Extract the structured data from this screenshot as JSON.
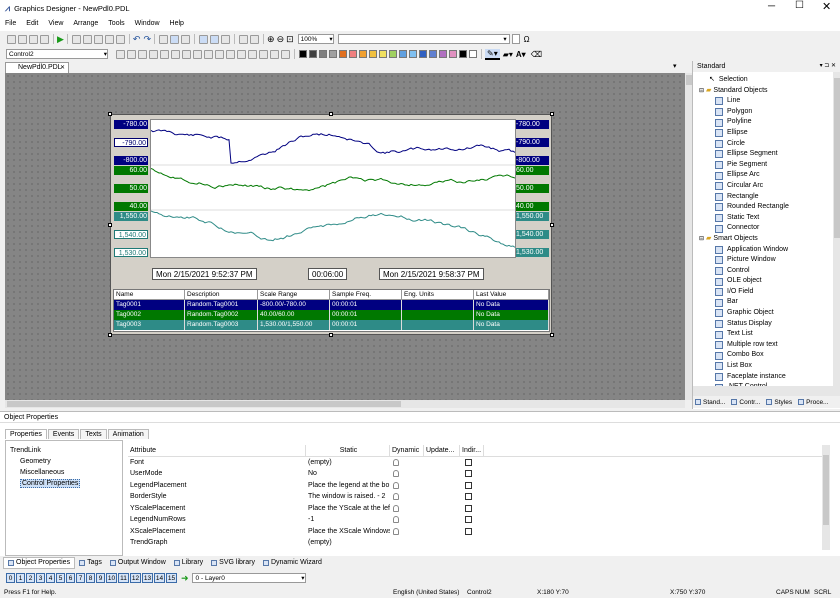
{
  "title": "Graphics Designer - NewPdl0.PDL",
  "menu": [
    "File",
    "Edit",
    "View",
    "Arrange",
    "Tools",
    "Window",
    "Help"
  ],
  "toolbar": {
    "zoom": "100%",
    "object_name": "Control2"
  },
  "document_tab": "NewPdl0.PDL",
  "trend": {
    "left_axis": {
      "blue": [
        "-780.00",
        "-790.00",
        "-800.00"
      ],
      "green": [
        "60.00",
        "50.00",
        "40.00"
      ],
      "teal": [
        "1,550.00",
        "1,540.00",
        "1,530.00"
      ]
    },
    "right_axis": {
      "blue": [
        "-780.00",
        "-790.00",
        "-800.00"
      ],
      "green": [
        "60.00",
        "50.00",
        "40.00"
      ],
      "teal": [
        "1,550.00",
        "1,540.00",
        "1,530.00"
      ]
    },
    "time_start": "Mon 2/15/2021   9:52:37 PM",
    "time_range": "00:06:00",
    "time_end": "Mon 2/15/2021   9:58:37 PM",
    "columns": [
      "Name",
      "Description",
      "Scale Range",
      "Sample Freq.",
      "Eng. Units",
      "Last Value"
    ],
    "rows": [
      [
        "Tag0001",
        "Random.Tag0001",
        "-800.00/-780.00",
        "00:00:01",
        "",
        "No Data"
      ],
      [
        "Tag0002",
        "Random.Tag0002",
        "40.00/60.00",
        "00:00:01",
        "",
        "No Data"
      ],
      [
        "Tag0003",
        "Random.Tag0003",
        "1,530.00/1,550.00",
        "00:00:01",
        "",
        "No Data"
      ]
    ],
    "colors": {
      "blue": "#000080",
      "green": "#007800",
      "teal": "#2e8b87"
    }
  },
  "standard_panel": {
    "title": "Standard",
    "selection": "Selection",
    "standard_objects": "Standard Objects",
    "std_items": [
      "Line",
      "Polygon",
      "Polyline",
      "Ellipse",
      "Circle",
      "Ellipse Segment",
      "Pie Segment",
      "Ellipse Arc",
      "Circular Arc",
      "Rectangle",
      "Rounded Rectangle",
      "Static Text",
      "Connector"
    ],
    "smart_objects": "Smart Objects",
    "smart_items": [
      "Application Window",
      "Picture Window",
      "Control",
      "OLE object",
      "I/O Field",
      "Bar",
      "Graphic Object",
      "Status Display",
      "Text List",
      "Multiple row text",
      "Combo Box",
      "List Box",
      "Faceplate instance",
      ".NET Control"
    ],
    "tabs": [
      "Stand...",
      "Contr...",
      "Styles",
      "Proce..."
    ]
  },
  "object_properties": {
    "title": "Object Properties",
    "tabs": [
      "Properties",
      "Events",
      "Texts",
      "Animation"
    ],
    "tree": [
      "TrendLink",
      "Geometry",
      "Miscellaneous",
      "Control Properties"
    ],
    "headers": [
      "Attribute",
      "Static",
      "Dynamic",
      "Update...",
      "Indir..."
    ],
    "rows": [
      [
        "Font",
        "(empty)"
      ],
      [
        "UserMode",
        "No"
      ],
      [
        "LegendPlacement",
        "Place the legend at the bo"
      ],
      [
        "BorderStyle",
        "The window is raised. - 2"
      ],
      [
        "YScalePlacement",
        "Place the YScale at the left"
      ],
      [
        "LegendNumRows",
        "-1"
      ],
      [
        "XScalePlacement",
        "Place the XScale Windows"
      ],
      [
        "TrendGraph",
        "(empty)"
      ]
    ]
  },
  "bottom_tabs": [
    "Object Properties",
    "Tags",
    "Output Window",
    "Library",
    "SVG library",
    "Dynamic Wizard"
  ],
  "layers": [
    "0",
    "1",
    "2",
    "3",
    "4",
    "5",
    "6",
    "7",
    "8",
    "9",
    "10",
    "11",
    "12",
    "13",
    "14",
    "15"
  ],
  "layer_select": "0 - Layer0",
  "status": {
    "help": "Press F1 for Help.",
    "language": "English (United States)",
    "object": "Control2",
    "pos": "X:180 Y:70",
    "size": "X:750 Y:370",
    "caps": "CAPS",
    "num": "NUM",
    "scrl": "SCRL"
  }
}
